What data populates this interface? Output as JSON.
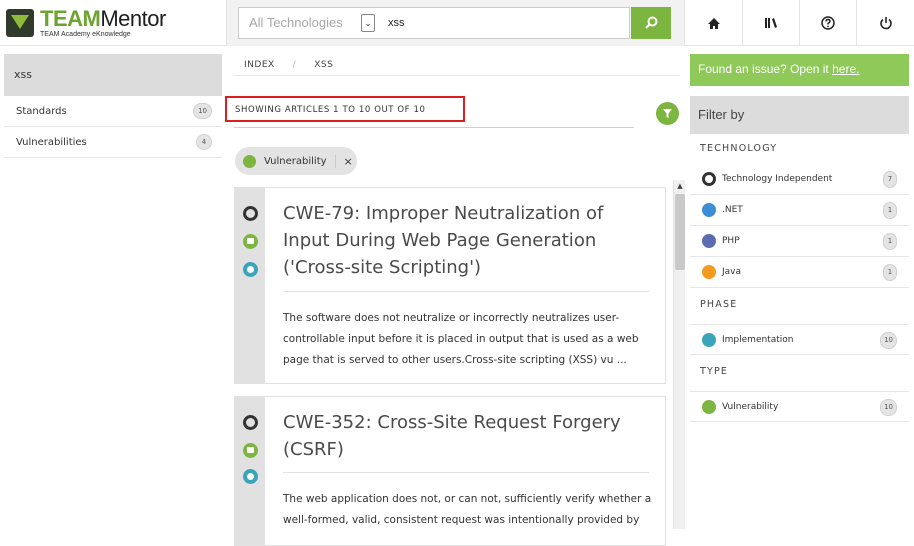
{
  "header": {
    "logo_title_bold": "TEAM",
    "logo_title_rest": "Mentor",
    "logo_subtitle": "TEAM Academy eKnowledge",
    "technology_select": {
      "placeholder": "All Technologies"
    },
    "search": {
      "value": "xss"
    },
    "nav": [
      "home-icon",
      "library-icon",
      "help-icon",
      "power-icon"
    ]
  },
  "left_panel": {
    "title": "xss",
    "items": [
      {
        "label": "Standards",
        "count": "10"
      },
      {
        "label": "Vulnerabilities",
        "count": "4"
      }
    ]
  },
  "breadcrumb": {
    "index": "INDEX",
    "sep": "/",
    "current": "XSS"
  },
  "results": {
    "showing": "SHOWING ARTICLES 1 TO 10 OUT OF 10",
    "active_filter": "Vulnerability",
    "remove_label": "×"
  },
  "articles": [
    {
      "title": "CWE-79: Improper Neutralization of Input During Web Page Generation ('Cross-site Scripting')",
      "body": "The software does not neutralize or incorrectly neutralizes user-controllable input before it is placed in output that is used as a web page that is served to other users.Cross-site scripting (XSS) vu ..."
    },
    {
      "title": "CWE-352: Cross-Site Request Forgery (CSRF)",
      "body": "The web application does not, or can not, sufficiently verify whether a well-formed, valid, consistent request was intentionally provided by"
    }
  ],
  "right_panel": {
    "issue_text": "Found an issue? Open it ",
    "issue_link": "here.",
    "filter_title": "Filter by",
    "sections": {
      "technology": {
        "label": "TECHNOLOGY",
        "items": [
          {
            "label": "Technology Independent",
            "count": "7"
          },
          {
            "label": ".NET",
            "count": "1"
          },
          {
            "label": "PHP",
            "count": "1"
          },
          {
            "label": "Java",
            "count": "1"
          }
        ]
      },
      "phase": {
        "label": "PHASE",
        "items": [
          {
            "label": "Implementation",
            "count": "10"
          }
        ]
      },
      "type": {
        "label": "TYPE",
        "items": [
          {
            "label": "Vulnerability",
            "count": "10"
          }
        ]
      }
    }
  },
  "colors": {
    "accent_green": "#7cb540",
    "issue_green": "#8fc95a",
    "highlight_red": "#d9201f",
    "teal": "#3aa4b8"
  }
}
